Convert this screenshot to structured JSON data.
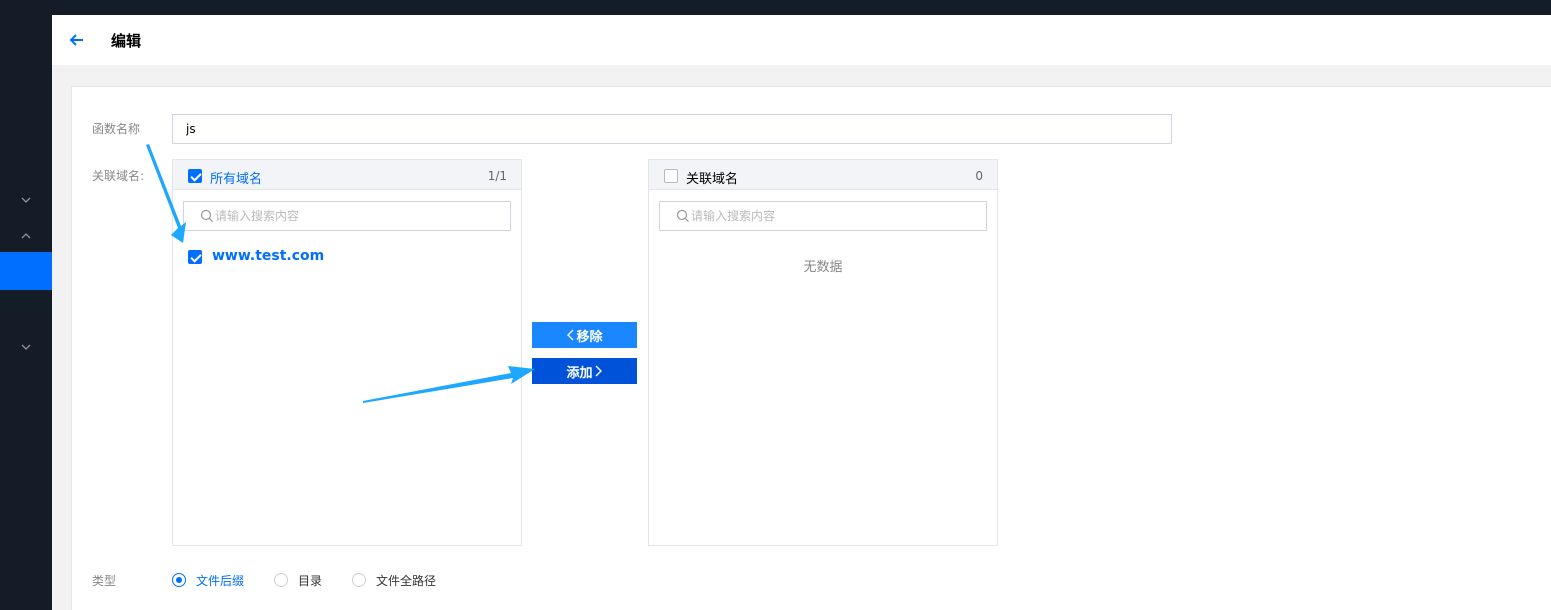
{
  "header": {
    "title": "编辑"
  },
  "form": {
    "name_label": "函数名称",
    "name_value": "js",
    "domain_label": "关联域名:",
    "type_label": "类型"
  },
  "left_panel": {
    "title": "所有域名",
    "count": "1/1",
    "search_placeholder": "请输入搜索内容",
    "items": [
      {
        "label": "www.test.com",
        "checked": true
      }
    ]
  },
  "right_panel": {
    "title": "关联域名",
    "count": "0",
    "search_placeholder": "请输入搜索内容",
    "empty_text": "无数据"
  },
  "buttons": {
    "remove_label": "移除",
    "add_label": "添加"
  },
  "type_options": [
    {
      "label": "文件后缀",
      "selected": true
    },
    {
      "label": "目录",
      "selected": false
    },
    {
      "label": "文件全路径",
      "selected": false
    }
  ],
  "colors": {
    "accent": "#006eff",
    "sidebar": "#131c27",
    "annotation_arrow": "#1ea7ff"
  }
}
